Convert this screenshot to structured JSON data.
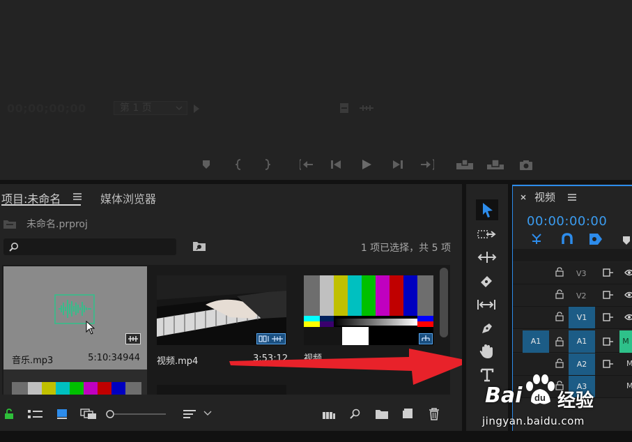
{
  "monitor": {
    "timecode": "00;00;00;00",
    "page_select": "第 1 页"
  },
  "project": {
    "tab_project": "项目:未命名",
    "tab_media": "媒体浏览器",
    "file_name": "未命名.prproj",
    "search_placeholder": "",
    "selection_status": "1 项已选择，共 5 项",
    "clips": [
      {
        "name": "音乐.mp3",
        "duration": "5:10:34944"
      },
      {
        "name": "视频.mp4",
        "duration": "3:53:12"
      },
      {
        "name": "视频",
        "duration": ""
      }
    ]
  },
  "timeline": {
    "tab_title": "视频",
    "timecode": "00:00:00:00",
    "tracks": {
      "v3": "V3",
      "v2": "V2",
      "v1": "V1",
      "a1_source": "A1",
      "a1": "A1",
      "a2": "A2",
      "a3": "A3",
      "m_label": "M"
    }
  },
  "watermark": {
    "brand_left": "Bai",
    "brand_right": "经验",
    "url": "jingyan.baidu.com"
  },
  "colors": {
    "accent_blue": "#2d8ceb",
    "track_blue": "#1c5c86",
    "audio_green": "#2ec18a",
    "arrow_red": "#e8222a"
  }
}
